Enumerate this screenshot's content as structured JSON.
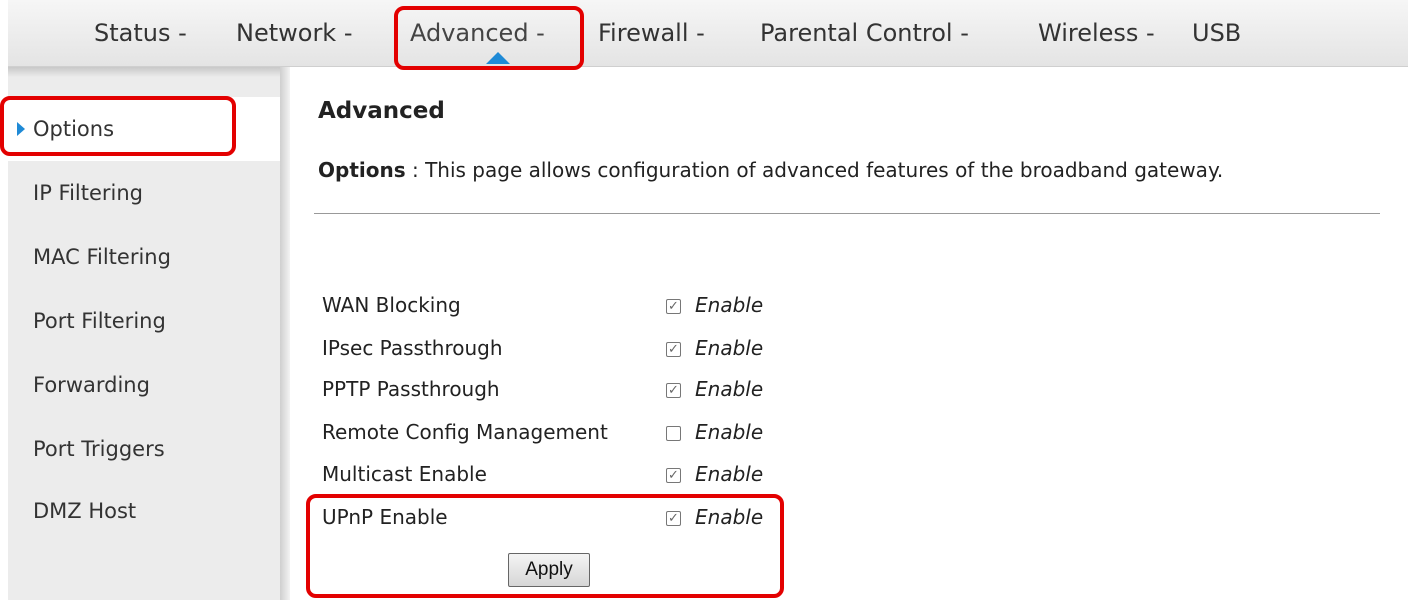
{
  "topnav": {
    "items": [
      {
        "label": "Status -"
      },
      {
        "label": "Network -"
      },
      {
        "label": "Advanced -"
      },
      {
        "label": "Firewall -"
      },
      {
        "label": "Parental Control -"
      },
      {
        "label": "Wireless -"
      },
      {
        "label": "USB"
      }
    ],
    "active_index": 2
  },
  "sidebar": {
    "items": [
      {
        "label": "Options"
      },
      {
        "label": "IP Filtering"
      },
      {
        "label": "MAC Filtering"
      },
      {
        "label": "Port Filtering"
      },
      {
        "label": "Forwarding"
      },
      {
        "label": "Port Triggers"
      },
      {
        "label": "DMZ Host"
      }
    ],
    "active_index": 0
  },
  "main": {
    "title": "Advanced",
    "desc_label": "Options",
    "desc_sep": " : ",
    "desc_text": "This page allows configuration of advanced features of the broadband gateway.",
    "options": [
      {
        "label": "WAN Blocking",
        "checked": true,
        "enable_label": "Enable"
      },
      {
        "label": "IPsec Passthrough",
        "checked": true,
        "enable_label": "Enable"
      },
      {
        "label": "PPTP Passthrough",
        "checked": true,
        "enable_label": "Enable"
      },
      {
        "label": "Remote Config Management",
        "checked": false,
        "enable_label": "Enable"
      },
      {
        "label": "Multicast Enable",
        "checked": true,
        "enable_label": "Enable"
      },
      {
        "label": "UPnP Enable",
        "checked": true,
        "enable_label": "Enable"
      }
    ],
    "apply_label": "Apply"
  },
  "colors": {
    "accent": "#1f8ad6",
    "highlight": "#e30000"
  }
}
